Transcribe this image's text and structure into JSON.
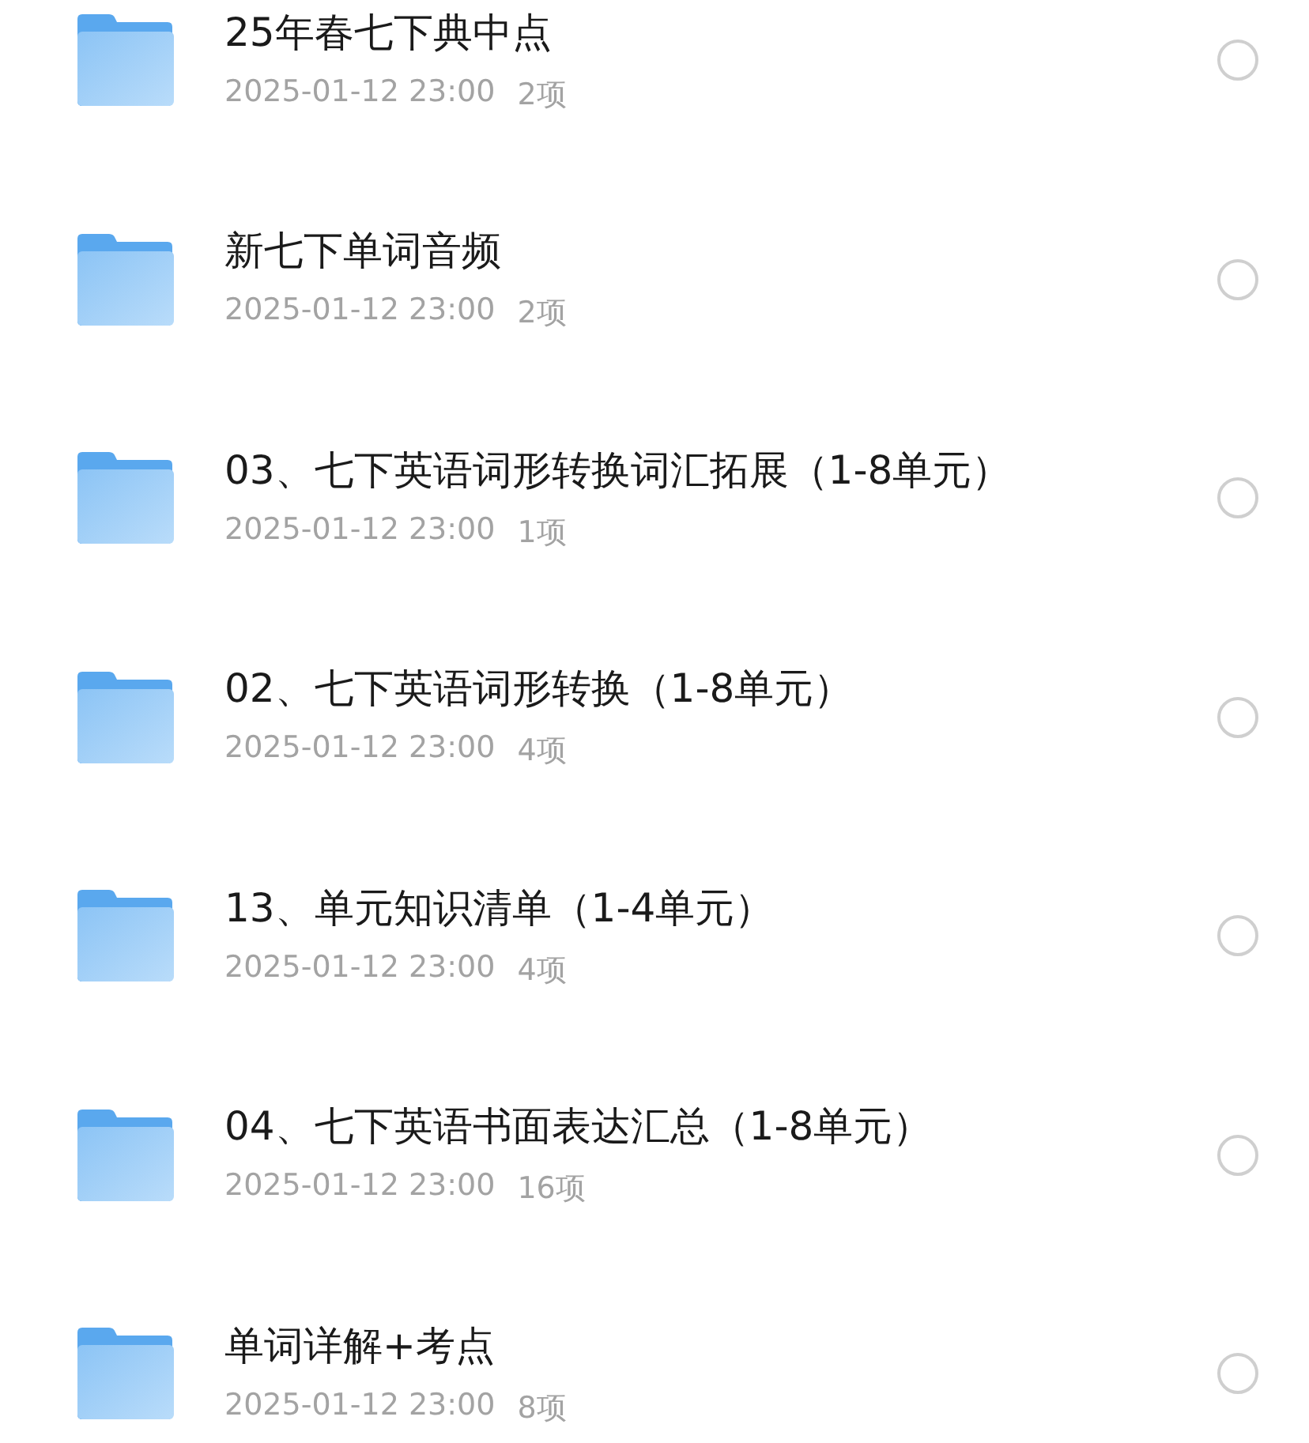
{
  "files": [
    {
      "name": "25年春七下典中点",
      "date": "2025-01-12 23:00",
      "count": "2项",
      "selected": false
    },
    {
      "name": "新七下单词音频",
      "date": "2025-01-12 23:00",
      "count": "2项",
      "selected": false
    },
    {
      "name": "03、七下英语词形转换词汇拓展（1-8单元）",
      "date": "2025-01-12 23:00",
      "count": "1项",
      "selected": false
    },
    {
      "name": "02、七下英语词形转换（1-8单元）",
      "date": "2025-01-12 23:00",
      "count": "4项",
      "selected": false
    },
    {
      "name": "13、单元知识清单（1-4单元）",
      "date": "2025-01-12 23:00",
      "count": "4项",
      "selected": false
    },
    {
      "name": "04、七下英语书面表达汇总（1-8单元）",
      "date": "2025-01-12 23:00",
      "count": "16项",
      "selected": false
    },
    {
      "name": "单词详解+考点",
      "date": "2025-01-12 23:00",
      "count": "8项",
      "selected": false
    }
  ]
}
